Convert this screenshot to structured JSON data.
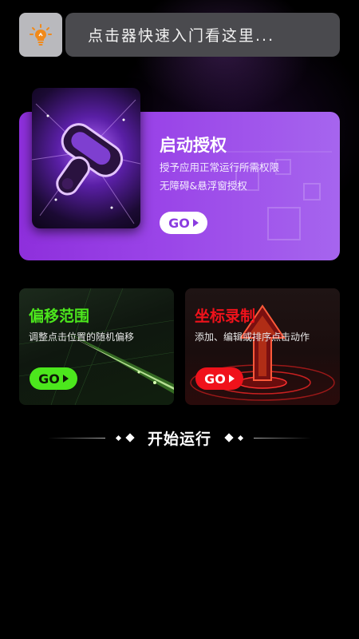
{
  "header": {
    "help_icon": "lightbulb-icon",
    "hint_text": "点击器快速入门看这里..."
  },
  "auth_card": {
    "title": "启动授权",
    "desc_line1": "授予应用正常运行所需权限",
    "desc_line2": "无障碍&悬浮窗授权",
    "go_label": "GO",
    "accent": "#9a45e8"
  },
  "offset_card": {
    "title": "偏移范围",
    "desc": "调整点击位置的随机偏移",
    "go_label": "GO",
    "accent": "#4ce71d"
  },
  "coord_card": {
    "title": "坐标录制",
    "desc": "添加、编辑或排序点击动作",
    "go_label": "GO",
    "accent": "#f0121b"
  },
  "start": {
    "label": "开始运行"
  }
}
